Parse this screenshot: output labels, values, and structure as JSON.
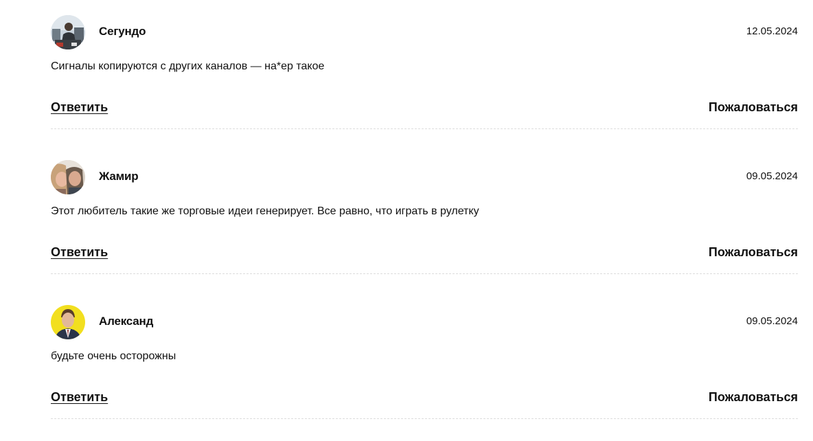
{
  "comments": [
    {
      "author": "Сегундо",
      "date": "12.05.2024",
      "text": "Сигналы копируются с других каналов — на*ер такое",
      "reply_label": "Ответить",
      "report_label": "Пожаловаться",
      "avatar_icon": "user-avatar-photo"
    },
    {
      "author": "Жамир",
      "date": "09.05.2024",
      "text": "Этот любитель такие же торговые идеи генерирует. Все равно, что играть в рулетку",
      "reply_label": "Ответить",
      "report_label": "Пожаловаться",
      "avatar_icon": "user-avatar-photo"
    },
    {
      "author": "Александ",
      "date": "09.05.2024",
      "text": "будьте очень осторожны",
      "reply_label": "Ответить",
      "report_label": "Пожаловаться",
      "avatar_icon": "user-avatar-photo"
    }
  ],
  "colors": {
    "text": "#111111",
    "divider": "#dcdcdc",
    "background": "#ffffff"
  }
}
